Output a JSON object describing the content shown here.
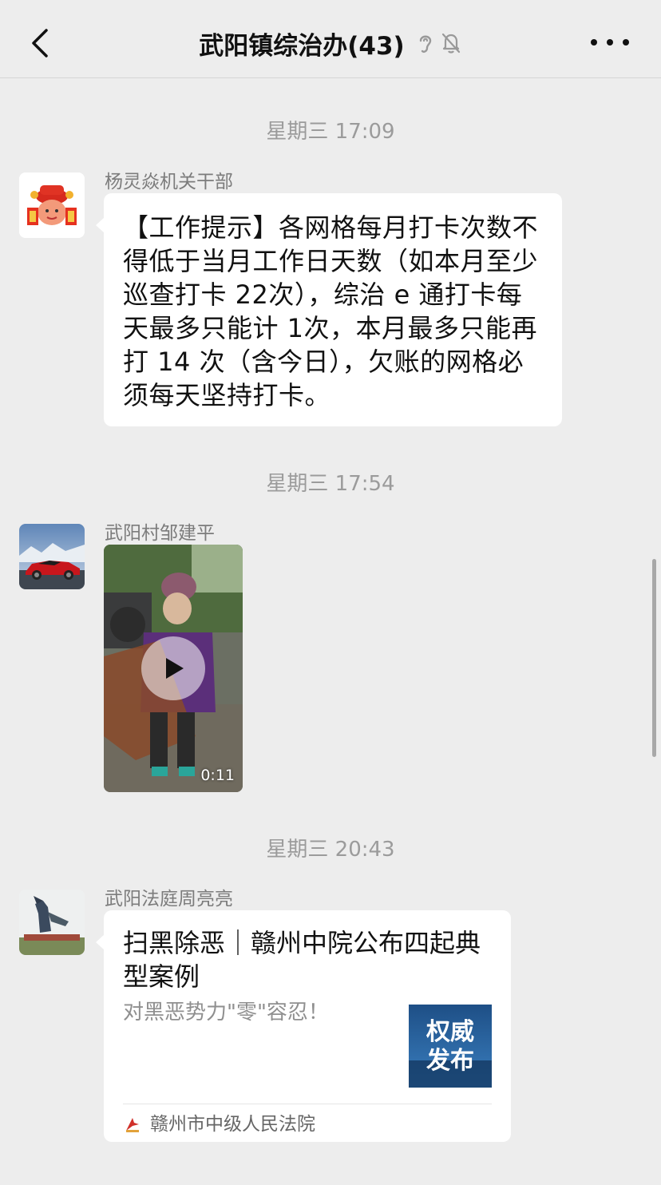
{
  "header": {
    "title": "武阳镇综治办(43)",
    "back_icon": "chevron-left-icon",
    "ear_icon": "ear-icon",
    "mute_icon": "bell-slash-icon",
    "more_icon": "more-dots-icon"
  },
  "messages": [
    {
      "timestamp": "星期三 17:09",
      "sender": "杨灵焱机关干部",
      "type": "text",
      "text": "【工作提示】各网格每月打卡次数不得低于当月工作日天数（如本月至少巡查打卡 22次），综治 e 通打卡每天最多只能计 1次，本月最多只能再打 14 次（含今日），欠账的网格必须每天坚持打卡。"
    },
    {
      "timestamp": "星期三 17:54",
      "sender": "武阳村邹建平",
      "type": "video",
      "duration": "0:11"
    },
    {
      "timestamp": "星期三 20:43",
      "sender": "武阳法庭周亮亮",
      "type": "link-card",
      "card_title": "扫黑除恶｜赣州中院公布四起典型案例",
      "card_desc": "对黑恶势力\"零\"容忍！",
      "thumb_text_1": "权威",
      "thumb_text_2": "发布",
      "source": "赣州市中级人民法院"
    }
  ],
  "colors": {
    "background": "#ededed",
    "bubble": "#ffffff",
    "timestamp": "#9b9b9b",
    "sender": "#7c7c7c"
  }
}
